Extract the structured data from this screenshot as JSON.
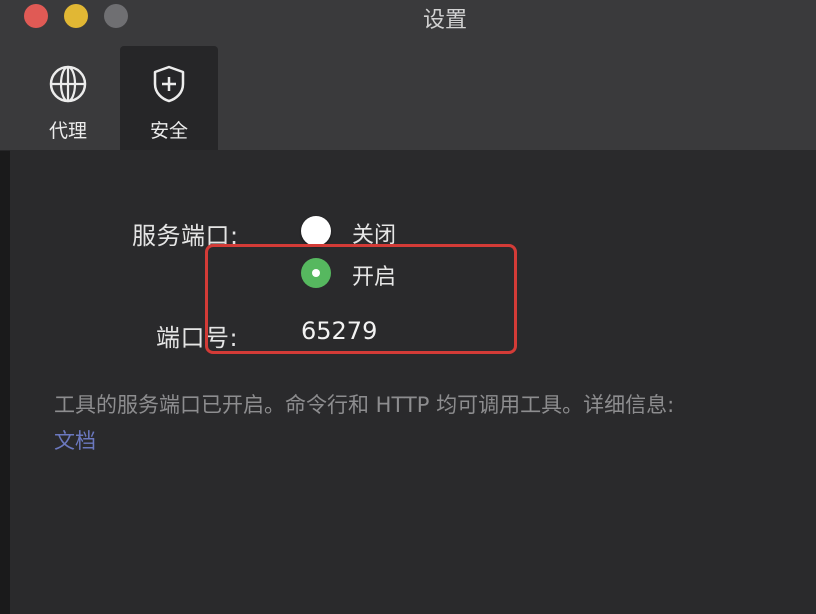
{
  "window": {
    "title": "设置"
  },
  "tabs": [
    {
      "label": "代理",
      "icon": "globe-icon",
      "active": false
    },
    {
      "label": "安全",
      "icon": "shield-plus-icon",
      "active": true
    }
  ],
  "security": {
    "service_port_label": "服务端口:",
    "options": [
      {
        "label": "关闭",
        "selected": false
      },
      {
        "label": "开启",
        "selected": true
      }
    ],
    "port_label": "端口号:",
    "port_value": "65279",
    "info_text": "工具的服务端口已开启。命令行和 HTTP 均可调用工具。详细信息:",
    "doc_link_label": "文档"
  },
  "colors": {
    "radio_selected": "#56b85f",
    "highlight_border": "#d33b37",
    "link": "#6b78bf"
  }
}
